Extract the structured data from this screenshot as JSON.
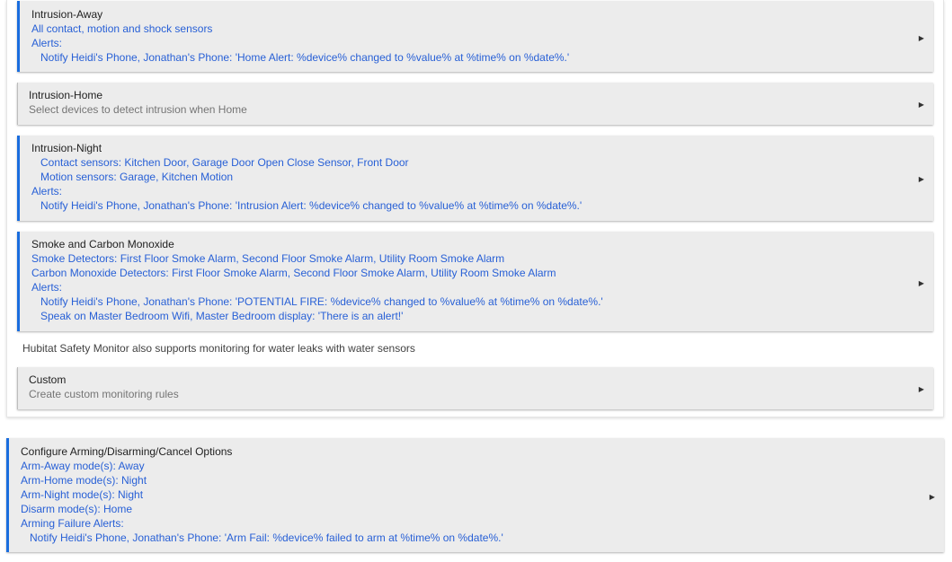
{
  "sections": {
    "intrusion_away": {
      "title": "Intrusion-Away",
      "devices": "All contact, motion and shock sensors",
      "alerts_label": "Alerts:",
      "notify": "Notify Heidi's Phone, Jonathan's Phone: 'Home Alert: %device% changed to %value% at %time% on %date%.'"
    },
    "intrusion_home": {
      "title": "Intrusion-Home",
      "description": "Select devices to detect intrusion when Home"
    },
    "intrusion_night": {
      "title": "Intrusion-Night",
      "contact": "Contact sensors: Kitchen Door, Garage Door Open Close Sensor, Front Door",
      "motion": "Motion sensors: Garage, Kitchen Motion",
      "alerts_label": "Alerts:",
      "notify": "Notify Heidi's Phone, Jonathan's Phone: 'Intrusion Alert: %device% changed to %value% at %time% on %date%.'"
    },
    "smoke_co": {
      "title": "Smoke and Carbon Monoxide",
      "smoke": "Smoke Detectors: First Floor Smoke Alarm, Second Floor Smoke Alarm, Utility Room Smoke Alarm",
      "co": "Carbon Monoxide Detectors: First Floor Smoke Alarm, Second Floor Smoke Alarm, Utility Room Smoke Alarm",
      "alerts_label": "Alerts:",
      "notify": "Notify Heidi's Phone, Jonathan's Phone: 'POTENTIAL FIRE: %device% changed to %value% at %time% on %date%.'",
      "speak": "Speak on Master Bedroom Wifi, Master Bedroom display: 'There is an alert!'"
    },
    "water_note": "Hubitat Safety Monitor also supports monitoring for water leaks with water sensors",
    "custom": {
      "title": "Custom",
      "description": "Create custom monitoring rules"
    },
    "arming": {
      "title": "Configure Arming/Disarming/Cancel Options",
      "arm_away": "Arm-Away mode(s): Away",
      "arm_home": "Arm-Home mode(s): Night",
      "arm_night": "Arm-Night mode(s): Night",
      "disarm": "Disarm mode(s): Home",
      "failure_label": "Arming Failure Alerts:",
      "notify": "Notify Heidi's Phone, Jonathan's Phone: 'Arm Fail: %device% failed to arm at %time% on %date%.'"
    }
  },
  "icons": {
    "expand": "▶"
  },
  "colors": {
    "accent": "#1a6dde",
    "link_text": "#2860d6",
    "panel_bg": "#ececec",
    "muted_text": "#757575"
  }
}
